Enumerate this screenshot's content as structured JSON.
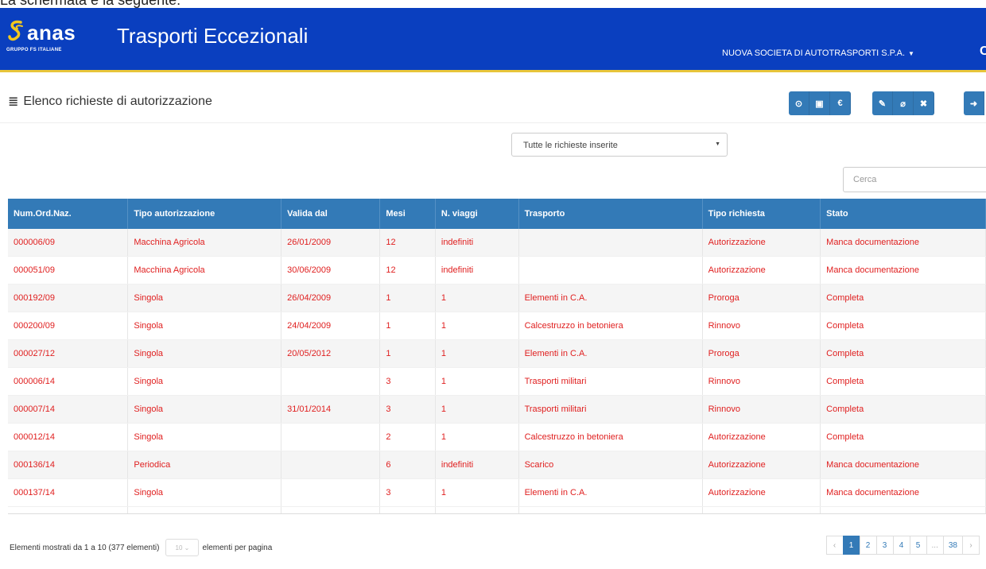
{
  "caption": "La schermata è la seguente:",
  "header": {
    "brand": "anas",
    "brand_sub": "GRUPPO FS ITALIANE",
    "app_title": "Trasporti Eccezionali",
    "company": "NUOVA SOCIETA DI AUTOTRASPORTI S.P.A.",
    "edge_glyph": "C"
  },
  "page": {
    "title": "Elenco richieste di autorizzazione"
  },
  "toolbar": {
    "groups": [
      [
        {
          "icon": "clock-icon",
          "glyph": "⊙"
        },
        {
          "icon": "pdf-icon",
          "glyph": "▣"
        },
        {
          "icon": "euro-icon",
          "glyph": "€"
        }
      ],
      [
        {
          "icon": "pencil-icon",
          "glyph": "✎"
        },
        {
          "icon": "paperclip-icon",
          "glyph": "⌀"
        },
        {
          "icon": "close-icon",
          "glyph": "✖"
        }
      ],
      [
        {
          "icon": "logout-icon",
          "glyph": "➜"
        }
      ]
    ]
  },
  "filter": {
    "selected": "Tutte le richieste inserite"
  },
  "search": {
    "placeholder": "Cerca"
  },
  "table": {
    "columns": [
      "Num.Ord.Naz.",
      "Tipo autorizzazione",
      "Valida dal",
      "Mesi",
      "N. viaggi",
      "Trasporto",
      "Tipo richiesta",
      "Stato"
    ],
    "rows": [
      [
        "000006/09",
        "Macchina Agricola",
        "26/01/2009",
        "12",
        "indefiniti",
        "",
        "Autorizzazione",
        "Manca documentazione"
      ],
      [
        "000051/09",
        "Macchina Agricola",
        "30/06/2009",
        "12",
        "indefiniti",
        "",
        "Autorizzazione",
        "Manca documentazione"
      ],
      [
        "000192/09",
        "Singola",
        "26/04/2009",
        "1",
        "1",
        "Elementi in C.A.",
        "Proroga",
        "Completa"
      ],
      [
        "000200/09",
        "Singola",
        "24/04/2009",
        "1",
        "1",
        "Calcestruzzo in betoniera",
        "Rinnovo",
        "Completa"
      ],
      [
        "000027/12",
        "Singola",
        "20/05/2012",
        "1",
        "1",
        "Elementi in C.A.",
        "Proroga",
        "Completa"
      ],
      [
        "000006/14",
        "Singola",
        "",
        "3",
        "1",
        "Trasporti militari",
        "Rinnovo",
        "Completa"
      ],
      [
        "000007/14",
        "Singola",
        "31/01/2014",
        "3",
        "1",
        "Trasporti militari",
        "Rinnovo",
        "Completa"
      ],
      [
        "000012/14",
        "Singola",
        "",
        "2",
        "1",
        "Calcestruzzo in betoniera",
        "Autorizzazione",
        "Completa"
      ],
      [
        "000136/14",
        "Periodica",
        "",
        "6",
        "indefiniti",
        "Scarico",
        "Autorizzazione",
        "Manca documentazione"
      ],
      [
        "000137/14",
        "Singola",
        "",
        "3",
        "1",
        "Elementi in C.A.",
        "Autorizzazione",
        "Manca documentazione"
      ]
    ]
  },
  "footer": {
    "info_prefix": "Elementi mostrati da 1 a 10 (377 elementi)",
    "page_size": "10",
    "info_suffix": "elementi per pagina"
  },
  "pagination": {
    "prev": "‹",
    "pages": [
      "1",
      "2",
      "3",
      "4",
      "5",
      "...",
      "38"
    ],
    "next": "›",
    "active": "1"
  },
  "colors": {
    "navbar": "#0a3fbf",
    "accent_line": "#e8c53a",
    "primary": "#337ab7",
    "row_text": "#e02020"
  }
}
